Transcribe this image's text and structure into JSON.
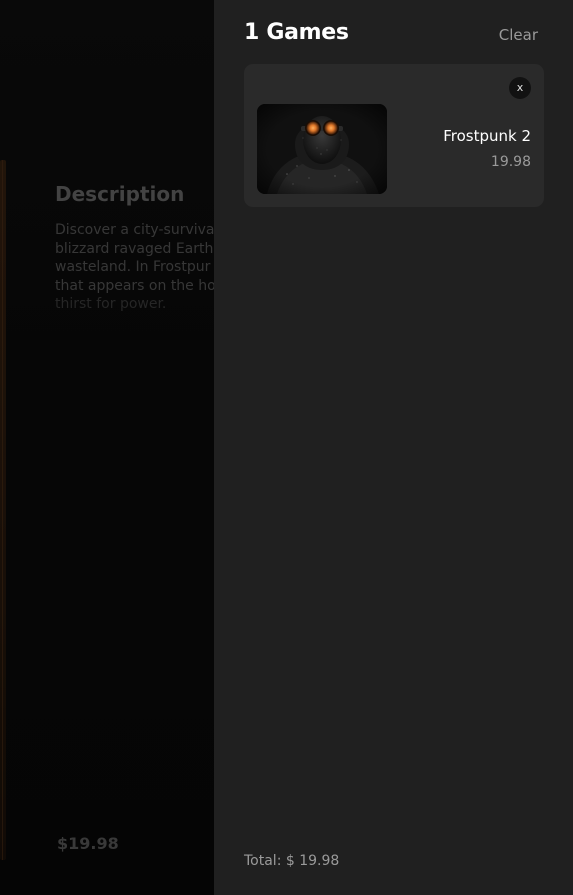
{
  "background": {
    "description_title": "Description",
    "description_lines": [
      "Discover a city-surviva",
      "blizzard ravaged Earth",
      "wasteland. In Frostpur",
      "that appears on the ho",
      "thirst for power."
    ],
    "price": "$19.98"
  },
  "cart": {
    "title": "1 Games",
    "clear_label": "Clear",
    "items": [
      {
        "name": "Frostpunk 2",
        "price": "19.98",
        "remove_label": "x",
        "image": "frostpunk-2-cover"
      }
    ],
    "total_label": "Total: $ 19.98"
  },
  "colors": {
    "drawer_bg": "#202020",
    "card_bg": "#2a2a2a",
    "muted_text": "#9a9a9a",
    "accent_orange": "#e0782a"
  }
}
